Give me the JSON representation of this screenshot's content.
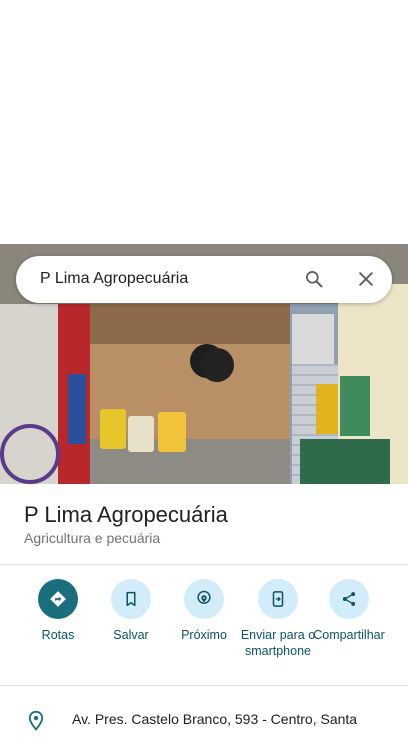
{
  "search": {
    "query": "P Lima Agropecuária"
  },
  "place": {
    "name": "P Lima Agropecuária",
    "category": "Agricultura e pecuária",
    "address": "Av. Pres. Castelo Branco, 593 - Centro, Santa"
  },
  "actions": [
    {
      "label": "Rotas",
      "icon": "directions-icon"
    },
    {
      "label": "Salvar",
      "icon": "bookmark-icon"
    },
    {
      "label": "Próximo",
      "icon": "nearby-icon"
    },
    {
      "label": "Enviar para o smartphone",
      "icon": "send-to-phone-icon"
    },
    {
      "label": "Compartilhar",
      "icon": "share-icon"
    }
  ],
  "colors": {
    "accent": "#1a6e7e",
    "action_circle": "#d2ecf9",
    "action_text": "#0b5566"
  }
}
